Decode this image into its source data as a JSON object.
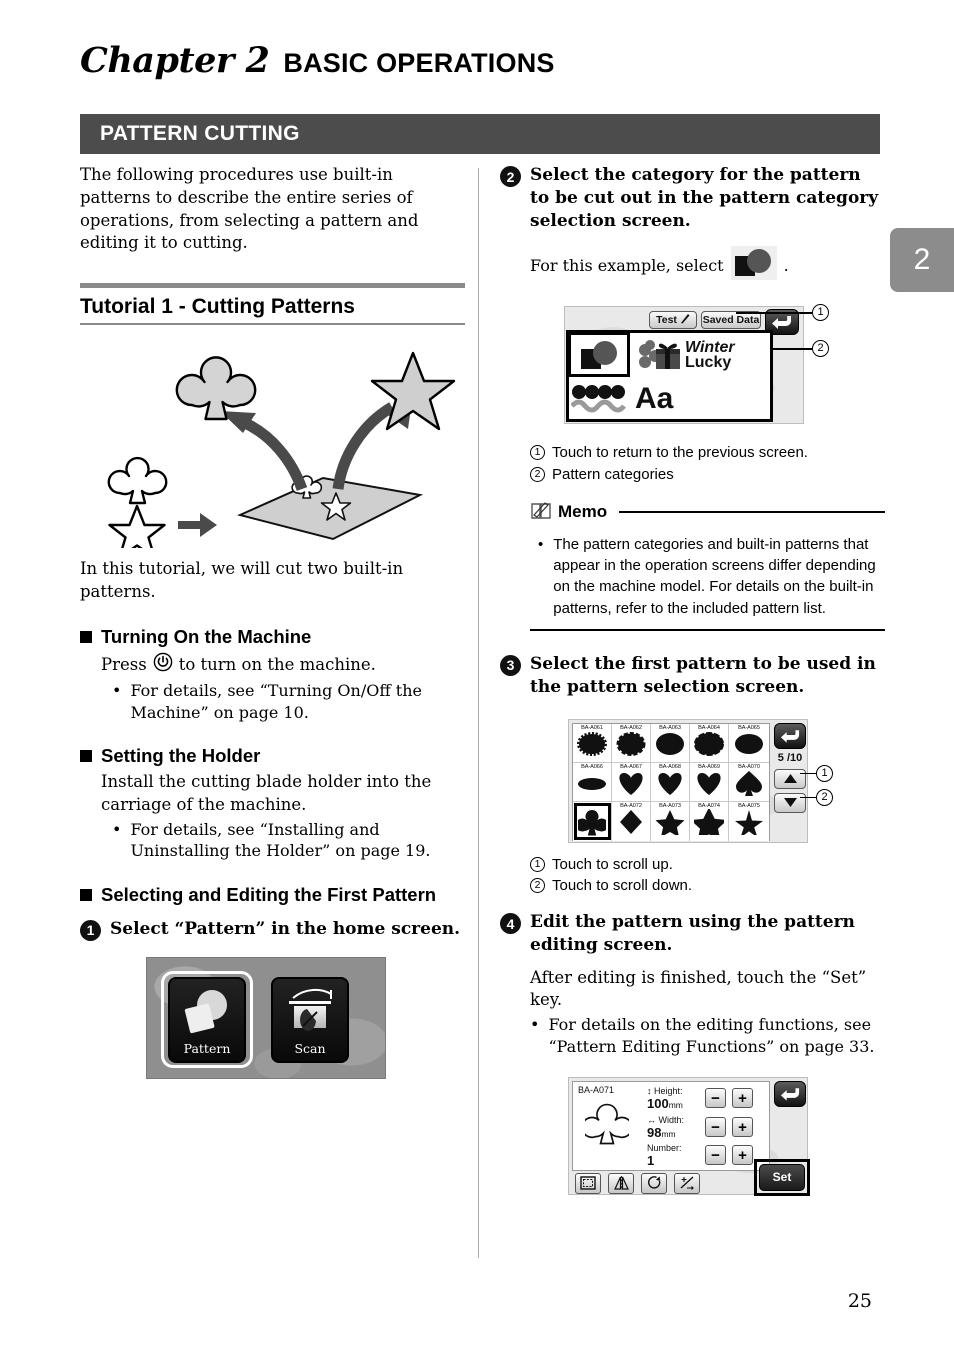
{
  "chapter": {
    "label": "Chapter 2",
    "title": "BASIC OPERATIONS",
    "tab_number": "2"
  },
  "section": {
    "title": "PATTERN CUTTING"
  },
  "page_number": "25",
  "left": {
    "intro": "The following procedures use built-in patterns to describe the entire series of operations, from selecting a pattern and editing it to cutting.",
    "tutorial_heading": "Tutorial 1 - Cutting Patterns",
    "illustration_caption": "In this tutorial, we will cut two built-in patterns.",
    "sections": [
      {
        "heading": "Turning On the Machine",
        "body": "Press ⓪ to turn on the machine.",
        "body_pre": "Press",
        "body_post": "to turn on the machine.",
        "bullets": [
          "For details, see “Turning On/Off the Machine” on page 10."
        ]
      },
      {
        "heading": "Setting the Holder",
        "body": "Install the cutting blade holder into the carriage of the machine.",
        "bullets": [
          "For details, see “Installing and Uninstalling the Holder” on page 19."
        ]
      },
      {
        "heading": "Selecting and Editing the First Pattern"
      }
    ],
    "step1": {
      "num": "1",
      "text": "Select “Pattern” in the home screen."
    },
    "home_screen": {
      "tiles": [
        {
          "label": "Pattern",
          "selected": true
        },
        {
          "label": "Scan",
          "selected": false
        }
      ]
    }
  },
  "right": {
    "step2": {
      "num": "2",
      "text": "Select the category for the pattern to be cut out in the pattern category selection screen.",
      "example_pre": "For this example, select",
      "example_post": "."
    },
    "category_screen": {
      "test_label": "Test",
      "saved_data_label": "Saved Data",
      "categories": [
        {
          "name": "shapes-category",
          "selected": true
        },
        {
          "name": "seasonal-category",
          "selected": false
        },
        {
          "name": "winter-lucky-category",
          "selected": false
        },
        {
          "name": "border-category",
          "selected": false
        },
        {
          "name": "font-category",
          "label": "Aa",
          "selected": false
        }
      ],
      "wordmark_line1": "Winter",
      "wordmark_line2": "Lucky"
    },
    "callouts_2": [
      {
        "num": "1",
        "text": "Touch to return to the previous screen."
      },
      {
        "num": "2",
        "text": "Pattern categories"
      }
    ],
    "memo": {
      "title": "Memo",
      "bullets": [
        "The pattern categories and built-in patterns that appear in the operation screens differ depending on the machine model. For details on the built-in patterns, refer to the included pattern list."
      ]
    },
    "step3": {
      "num": "3",
      "text": "Select the first pattern to be used in the pattern selection screen."
    },
    "pattern_screen": {
      "page_indicator": "5 /10",
      "rows": [
        [
          {
            "code": "BA-A061",
            "shape": "scalloped-oval"
          },
          {
            "code": "BA-A062",
            "shape": "wavy-oval"
          },
          {
            "code": "BA-A063",
            "shape": "oval"
          },
          {
            "code": "BA-A064",
            "shape": "wavy-oval-2"
          },
          {
            "code": "BA-A065",
            "shape": "ellipse"
          }
        ],
        [
          {
            "code": "BA-A066",
            "shape": "flat-ellipse"
          },
          {
            "code": "BA-A067",
            "shape": "heart"
          },
          {
            "code": "BA-A068",
            "shape": "heart-2"
          },
          {
            "code": "BA-A069",
            "shape": "heart-3"
          },
          {
            "code": "BA-A070",
            "shape": "spade"
          }
        ],
        [
          {
            "code": "BA-A071",
            "shape": "club",
            "selected": true
          },
          {
            "code": "BA-A072",
            "shape": "diamond"
          },
          {
            "code": "BA-A073",
            "shape": "star"
          },
          {
            "code": "BA-A074",
            "shape": "star-rounded"
          },
          {
            "code": "BA-A075",
            "shape": "star-slim"
          }
        ]
      ]
    },
    "callouts_3": [
      {
        "num": "1",
        "text": "Touch to scroll up."
      },
      {
        "num": "2",
        "text": "Touch to scroll down."
      }
    ],
    "step4": {
      "num": "4",
      "text": "Edit the pattern using the pattern editing screen.",
      "body": "After editing is finished, touch the “Set” key.",
      "bullets": [
        "For details on the editing functions, see “Pattern Editing Functions” on page 33."
      ]
    },
    "edit_screen": {
      "pattern_code": "BA-A071",
      "fields": [
        {
          "label": "Height:",
          "value": "100",
          "unit": "mm",
          "minus": "−",
          "plus": "+"
        },
        {
          "label": "Width:",
          "value": "98",
          "unit": "mm",
          "minus": "−",
          "plus": "+"
        },
        {
          "label": "Number:",
          "value": "1",
          "unit": "",
          "minus": "−",
          "plus": "+"
        }
      ],
      "tools": [
        "frame-icon",
        "mirror-flip-icon",
        "rotate-icon",
        "resize-icon"
      ],
      "set_label": "Set"
    }
  }
}
